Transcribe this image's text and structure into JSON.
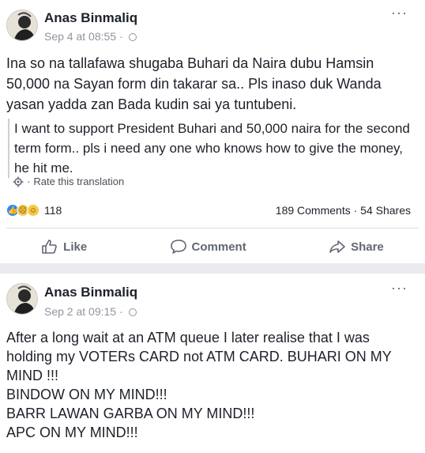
{
  "posts": [
    {
      "author": "Anas Binmaliq",
      "timestamp": "Sep 4 at 08:55",
      "text": "Ina so na tallafawa shugaba Buhari da Naira dubu Hamsin 50,000 na Sayan form din takarar sa..   Pls inaso duk Wanda yasan yadda zan Bada kudin sai ya tuntubeni.",
      "translation": "I want to support President Buhari and 50,000 naira for the second term form.. pls i need any one who knows how to give the money, he hit me.",
      "rate_label": "Rate this translation",
      "reaction_count": "118",
      "comments": "189 Comments",
      "shares": "54 Shares",
      "actions": {
        "like": "Like",
        "comment": "Comment",
        "share": "Share"
      }
    },
    {
      "author": "Anas Binmaliq",
      "timestamp": "Sep 2 at 09:15",
      "text": "After a long wait at an ATM queue I later realise that I was holding my VOTERs CARD not ATM CARD. BUHARI ON MY MIND !!!\nBINDOW ON MY MIND!!!\nBARR LAWAN GARBA ON MY MIND!!!\nAPC ON MY MIND!!!"
    }
  ],
  "icons": [
    "globe-icon",
    "more-options-icon",
    "gear-icon",
    "like-reaction-icon",
    "sad-reaction-icon",
    "haha-reaction-icon",
    "like-icon",
    "comment-icon",
    "share-icon"
  ],
  "colors": {
    "link_gray": "#90949c",
    "like_blue": "#2d88ff",
    "background": "#e9ebee"
  }
}
